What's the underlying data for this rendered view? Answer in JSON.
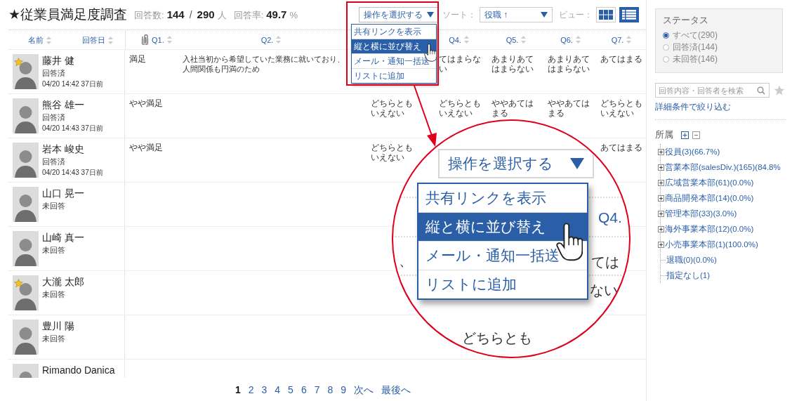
{
  "header": {
    "title": "★従業員満足度調査",
    "answered_label": "回答数:",
    "answered": "144",
    "separator": "/",
    "total": "290",
    "total_unit": "人",
    "rate_label": "回答率:",
    "rate": "49.7",
    "rate_unit": "%"
  },
  "action_select": {
    "value": "操作を選択する",
    "expanded": true,
    "options": [
      {
        "label": "共有リンクを表示",
        "selected": false
      },
      {
        "label": "縦と横に並び替え",
        "selected": true
      },
      {
        "label": "メール・通知一括送",
        "selected": false
      },
      {
        "label": "リストに追加",
        "selected": false
      }
    ]
  },
  "sort": {
    "label": "ソート：",
    "value": "役職 ↑"
  },
  "view": {
    "label": "ビュー：",
    "modes": [
      {
        "kind": "grid",
        "selected": false
      },
      {
        "kind": "list",
        "selected": true
      }
    ]
  },
  "table": {
    "name_columns": [
      {
        "label": "名前"
      },
      {
        "label": "回答日"
      }
    ],
    "question_headers": {
      "q1": {
        "label": "Q1.",
        "attachment": true
      },
      "q2": {
        "label": "Q2.",
        "attachment": false
      },
      "q4": {
        "label": "Q4.",
        "attachment": false
      },
      "q5": {
        "label": "Q5.",
        "attachment": false
      },
      "q6": {
        "label": "Q6.",
        "attachment": false
      },
      "q7": {
        "label": "Q7.",
        "attachment": false
      }
    },
    "rows": [
      {
        "name": "藤井 健",
        "status": "回答済",
        "date": "04/20 14:42 37日前",
        "starred": true,
        "answers": {
          "q1": "満足",
          "q2": "入社当初から希望していた業務に就いており、人間関係も円満のため",
          "q4": "てはまらない",
          "q5": "あまりあてはまらない",
          "q6": "あまりあてはまらない",
          "q7": "あてはまる"
        }
      },
      {
        "name": "熊谷 雄一",
        "status": "回答済",
        "date": "04/20 14:43 37日前",
        "starred": false,
        "answers": {
          "q1": "やや満足",
          "q3": "どちらともいえない",
          "q4": "どちらともいえない",
          "q5": "ややあてはまる",
          "q6": "ややあてはまる",
          "q7": "どちらともいえない"
        }
      },
      {
        "name": "岩本 峻史",
        "status": "回答済",
        "date": "04/20 14:43 37日前",
        "starred": false,
        "answers": {
          "q1": "やや満足",
          "q3": "どちらともいえない",
          "q7": "あてはまる"
        }
      },
      {
        "name": "山口 晃一",
        "status": "未回答",
        "starred": false
      },
      {
        "name": "山崎 真一",
        "status": "未回答",
        "starred": false
      },
      {
        "name": "大瀧 太郎",
        "status": "未回答",
        "starred": true
      },
      {
        "name": "豊川 陽",
        "status": "未回答",
        "starred": false
      },
      {
        "name": "Rimando Danica",
        "starred": false
      }
    ]
  },
  "magnifier": {
    "select_value": "操作を選択する",
    "options": [
      {
        "label": "共有リンクを表示",
        "selected": false
      },
      {
        "label": "縦と横に並び替え",
        "selected": true
      },
      {
        "label": "メール・通知一括送",
        "selected": false
      },
      {
        "label": "リストに追加",
        "selected": false
      }
    ],
    "column_label": "Q4.",
    "fragments": [
      "、",
      "ては",
      "ない",
      "どちらとも"
    ]
  },
  "sidebar": {
    "status": {
      "title": "ステータス",
      "options": [
        {
          "label": "すべて(290)",
          "selected": true
        },
        {
          "label": "回答済(144)",
          "selected": false
        },
        {
          "label": "未回答(146)",
          "selected": false
        }
      ]
    },
    "search": {
      "placeholder": "回答内容・回答者を検索"
    },
    "filter_link": "詳細条件で絞り込む",
    "department": {
      "title": "所属",
      "items": [
        {
          "label": "役員(3)(66.7%)",
          "kind": "branch",
          "expanded": false
        },
        {
          "label": "営業本部(salesDiv.)(165)(84.8%",
          "kind": "branch",
          "expanded": false
        },
        {
          "label": "広域営業本部(61)(0.0%)",
          "kind": "branch",
          "expanded": false
        },
        {
          "label": "商品開発本部(14)(0.0%)",
          "kind": "branch",
          "expanded": false
        },
        {
          "label": "管理本部(33)(3.0%)",
          "kind": "branch",
          "expanded": false
        },
        {
          "label": "海外事業本部(12)(0.0%)",
          "kind": "branch",
          "expanded": false
        },
        {
          "label": "小売事業本部(1)(100.0%)",
          "kind": "branch",
          "expanded": false
        },
        {
          "label": "退職(0)(0.0%)",
          "kind": "leaf"
        },
        {
          "label": "指定なし(1)",
          "kind": "leaf"
        }
      ]
    }
  },
  "pagination": {
    "pages": [
      {
        "label": "1",
        "selected": true
      },
      {
        "label": "2",
        "selected": false
      },
      {
        "label": "3",
        "selected": false
      },
      {
        "label": "4",
        "selected": false
      },
      {
        "label": "5",
        "selected": false
      },
      {
        "label": "6",
        "selected": false
      },
      {
        "label": "7",
        "selected": false
      },
      {
        "label": "8",
        "selected": false
      },
      {
        "label": "9",
        "selected": false
      }
    ],
    "next": "次へ",
    "last": "最後へ"
  }
}
